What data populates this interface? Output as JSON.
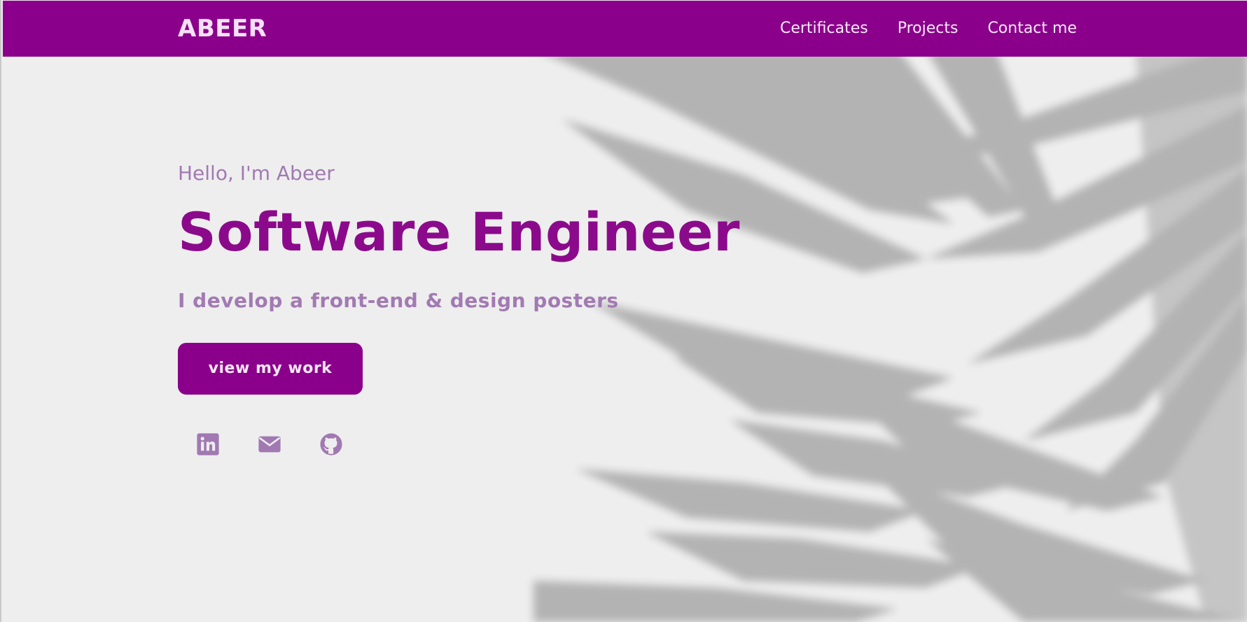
{
  "header": {
    "logo": "ABEER",
    "nav": [
      {
        "label": "Certificates"
      },
      {
        "label": "Projects"
      },
      {
        "label": "Contact me"
      }
    ]
  },
  "hero": {
    "greeting": "Hello, I'm Abeer",
    "headline": "Software Engineer",
    "tagline": "I develop a front-end & design posters",
    "cta_label": "view my work"
  },
  "socials": [
    {
      "icon": "linkedin-icon"
    },
    {
      "icon": "mail-icon"
    },
    {
      "icon": "github-icon"
    }
  ],
  "colors": {
    "brand": "#8b008b",
    "muted_purple": "#a179b2",
    "background": "#eeeeee",
    "shadow": "#b3b3b3"
  }
}
